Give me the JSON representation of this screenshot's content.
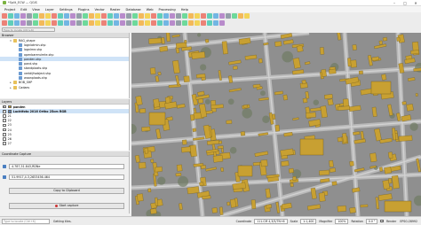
{
  "window": {
    "title": "*Split_ECW — QGIS"
  },
  "menu": [
    "Project",
    "Edit",
    "View",
    "Layer",
    "Settings",
    "Plugins",
    "Vector",
    "Raster",
    "Database",
    "Web",
    "Processing",
    "Help"
  ],
  "locator_placeholder": "Type to locate (Ctrl+K)",
  "browser": {
    "header": "Browser",
    "items": [
      {
        "label": "RAG_shape",
        "level": 1,
        "icon": "folder-icon",
        "expanded": true
      },
      {
        "label": "lognlatmin.shp",
        "level": 2,
        "icon": "shapefile-icon"
      },
      {
        "label": "lognlme.shp",
        "level": 2,
        "icon": "shapefile-icon"
      },
      {
        "label": "openbareruimte.shp",
        "level": 2,
        "icon": "shapefile-icon"
      },
      {
        "label": "panden.shp",
        "level": 2,
        "icon": "shapefile-icon",
        "selected": true
      },
      {
        "label": "pand.shp",
        "level": 2,
        "icon": "shapefile-icon"
      },
      {
        "label": "standplaats.shp",
        "level": 2,
        "icon": "shapefile-icon"
      },
      {
        "label": "verblijfsobject.shp",
        "level": 2,
        "icon": "shapefile-icon"
      },
      {
        "label": "woonplaats.shp",
        "level": 2,
        "icon": "shapefile-icon"
      },
      {
        "label": "BOB_SHP",
        "level": 1,
        "icon": "folder-icon"
      },
      {
        "label": "Cadaes",
        "level": 1,
        "icon": "folder-icon"
      }
    ]
  },
  "layers": {
    "header": "Layers",
    "items": [
      {
        "label": "panden",
        "checked": true,
        "bold": true,
        "swatch": "#d4a017"
      },
      {
        "label": "Luchtfoto 2016 Ortho 25cm RGB",
        "checked": true,
        "bold": true,
        "swatch": "#5a7fb0",
        "highlight": true
      },
      {
        "label": "21",
        "checked": false
      },
      {
        "label": "22",
        "checked": false
      },
      {
        "label": "23",
        "checked": false
      },
      {
        "label": "24",
        "checked": false
      },
      {
        "label": "25",
        "checked": false
      },
      {
        "label": "26",
        "checked": false
      },
      {
        "label": "27",
        "checked": false
      }
    ]
  },
  "coordinate_capture": {
    "header": "Coordinate Capture",
    "field1": "4.787,51.843,RDNe",
    "field2": "51.9917,4.3,2653456.464",
    "copy_button": "Copy to Clipboard",
    "start_button": "Start capture"
  },
  "status": {
    "search_placeholder": "Type to locate (Ctrl+K)",
    "message": "Getting tiles.",
    "coordinate_label": "Coordinate",
    "coordinate_value": "111.CM 4,3/5/7N+6",
    "scale_label": "Scale",
    "scale_value": "1:1,400",
    "magnifier_label": "Magnifier",
    "magnifier_value": "100%",
    "rotation_label": "Rotation",
    "rotation_value": "0.0 °",
    "render_label": "Render",
    "epsg": "EPSG:28992"
  },
  "colors": {
    "building": "#c8a032",
    "aerial_base": "#9a9a9a",
    "selection": "#cfe3f7"
  }
}
